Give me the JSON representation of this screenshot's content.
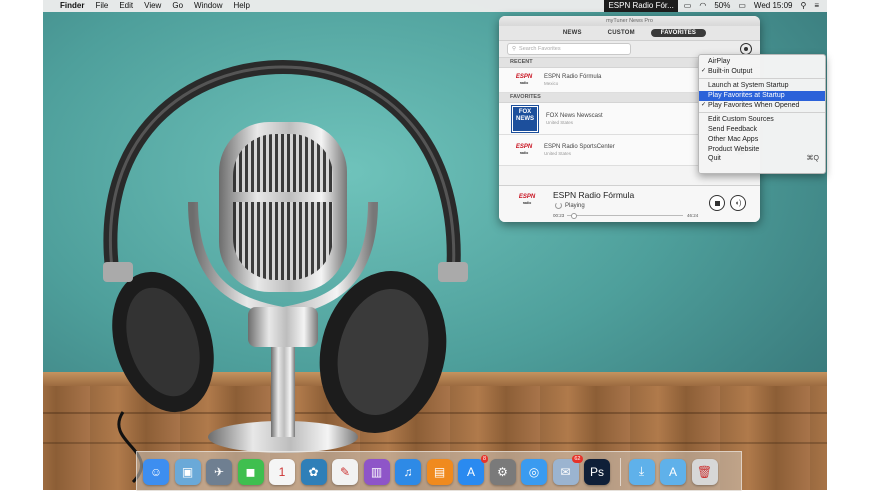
{
  "menubar": {
    "apple": "",
    "app_name": "Finder",
    "menus": [
      "File",
      "Edit",
      "View",
      "Go",
      "Window",
      "Help"
    ],
    "now_playing": "ESPN Radio Fór...",
    "battery": "50%",
    "clock": "Wed 15:09"
  },
  "window": {
    "title": "myTuner News Pro",
    "tabs": [
      {
        "label": "NEWS",
        "active": false
      },
      {
        "label": "CUSTOM",
        "active": false
      },
      {
        "label": "FAVORITES",
        "active": true
      }
    ],
    "search_placeholder": "Search Favorites",
    "sections": {
      "recent": "RECENT",
      "favorites": "FAVORITES"
    },
    "recent": [
      {
        "name": "ESPN Radio Fórmula",
        "country": "Mexico",
        "logo": "ESPN"
      }
    ],
    "favorites": [
      {
        "name": "FOX News Newscast",
        "country": "United States",
        "logo": "FOX NEWS"
      },
      {
        "name": "ESPN Radio SportsCenter",
        "country": "United States",
        "logo": "ESPN"
      }
    ],
    "player": {
      "logo": "ESPN",
      "station": "ESPN Radio Fórmula",
      "status": "Playing",
      "elapsed": "00:23",
      "total": "46:24",
      "progress": 0.05
    }
  },
  "menu": {
    "items": [
      {
        "label": "AirPlay",
        "checked": false,
        "highlight": false
      },
      {
        "label": "Built-in Output",
        "checked": true,
        "highlight": false
      },
      {
        "sep": true
      },
      {
        "label": "Launch at System Startup",
        "checked": false,
        "highlight": false
      },
      {
        "label": "Play Favorites at Startup",
        "checked": false,
        "highlight": true
      },
      {
        "label": "Play Favorites When Opened",
        "checked": true,
        "highlight": false
      },
      {
        "sep": true
      },
      {
        "label": "Edit Custom Sources",
        "checked": false,
        "highlight": false
      },
      {
        "label": "Send Feedback",
        "checked": false,
        "highlight": false
      },
      {
        "label": "Other Mac Apps",
        "checked": false,
        "highlight": false
      },
      {
        "label": "Product Website",
        "checked": false,
        "highlight": false
      },
      {
        "label": "Quit",
        "checked": false,
        "highlight": false,
        "shortcut": "⌘Q"
      }
    ]
  },
  "dock": {
    "apps": [
      {
        "name": "finder-icon",
        "color": "#3d8ef0",
        "glyph": "☺"
      },
      {
        "name": "preview-icon",
        "color": "#6aa9d8",
        "glyph": "▣"
      },
      {
        "name": "launchpad-icon",
        "color": "#6f7f91",
        "glyph": "✈"
      },
      {
        "name": "facetime-icon",
        "color": "#3fbf4f",
        "glyph": "◼"
      },
      {
        "name": "calendar-icon",
        "color": "#f5f5f5",
        "glyph": "1"
      },
      {
        "name": "photo-icon",
        "color": "#2f7fb8",
        "glyph": "✿"
      },
      {
        "name": "textedit-icon",
        "color": "#f2f2f2",
        "glyph": "✎"
      },
      {
        "name": "keynote-icon",
        "color": "#8e55c8",
        "glyph": "▥"
      },
      {
        "name": "itunes-icon",
        "color": "#2e8ae6",
        "glyph": "♫"
      },
      {
        "name": "ibooks-icon",
        "color": "#f08a1e",
        "glyph": "▤"
      },
      {
        "name": "appstore-icon",
        "color": "#2a8af0",
        "glyph": "A",
        "badge": "8"
      },
      {
        "name": "system-preferences-icon",
        "color": "#7a7a7a",
        "glyph": "⚙"
      },
      {
        "name": "safari-icon",
        "color": "#3a9bf0",
        "glyph": "◎"
      },
      {
        "name": "mail-stamp-icon",
        "color": "#9bb4d0",
        "glyph": "✉",
        "badge": "62"
      },
      {
        "name": "photoshop-icon",
        "color": "#0f1f38",
        "glyph": "Ps"
      }
    ],
    "folders": [
      {
        "name": "downloads-folder-icon",
        "color": "#5fb1ea",
        "glyph": "⤓"
      },
      {
        "name": "applications-folder-icon",
        "color": "#5fb1ea",
        "glyph": "A"
      },
      {
        "name": "trash-icon",
        "color": "#d7d7d7",
        "glyph": "🗑"
      }
    ]
  }
}
